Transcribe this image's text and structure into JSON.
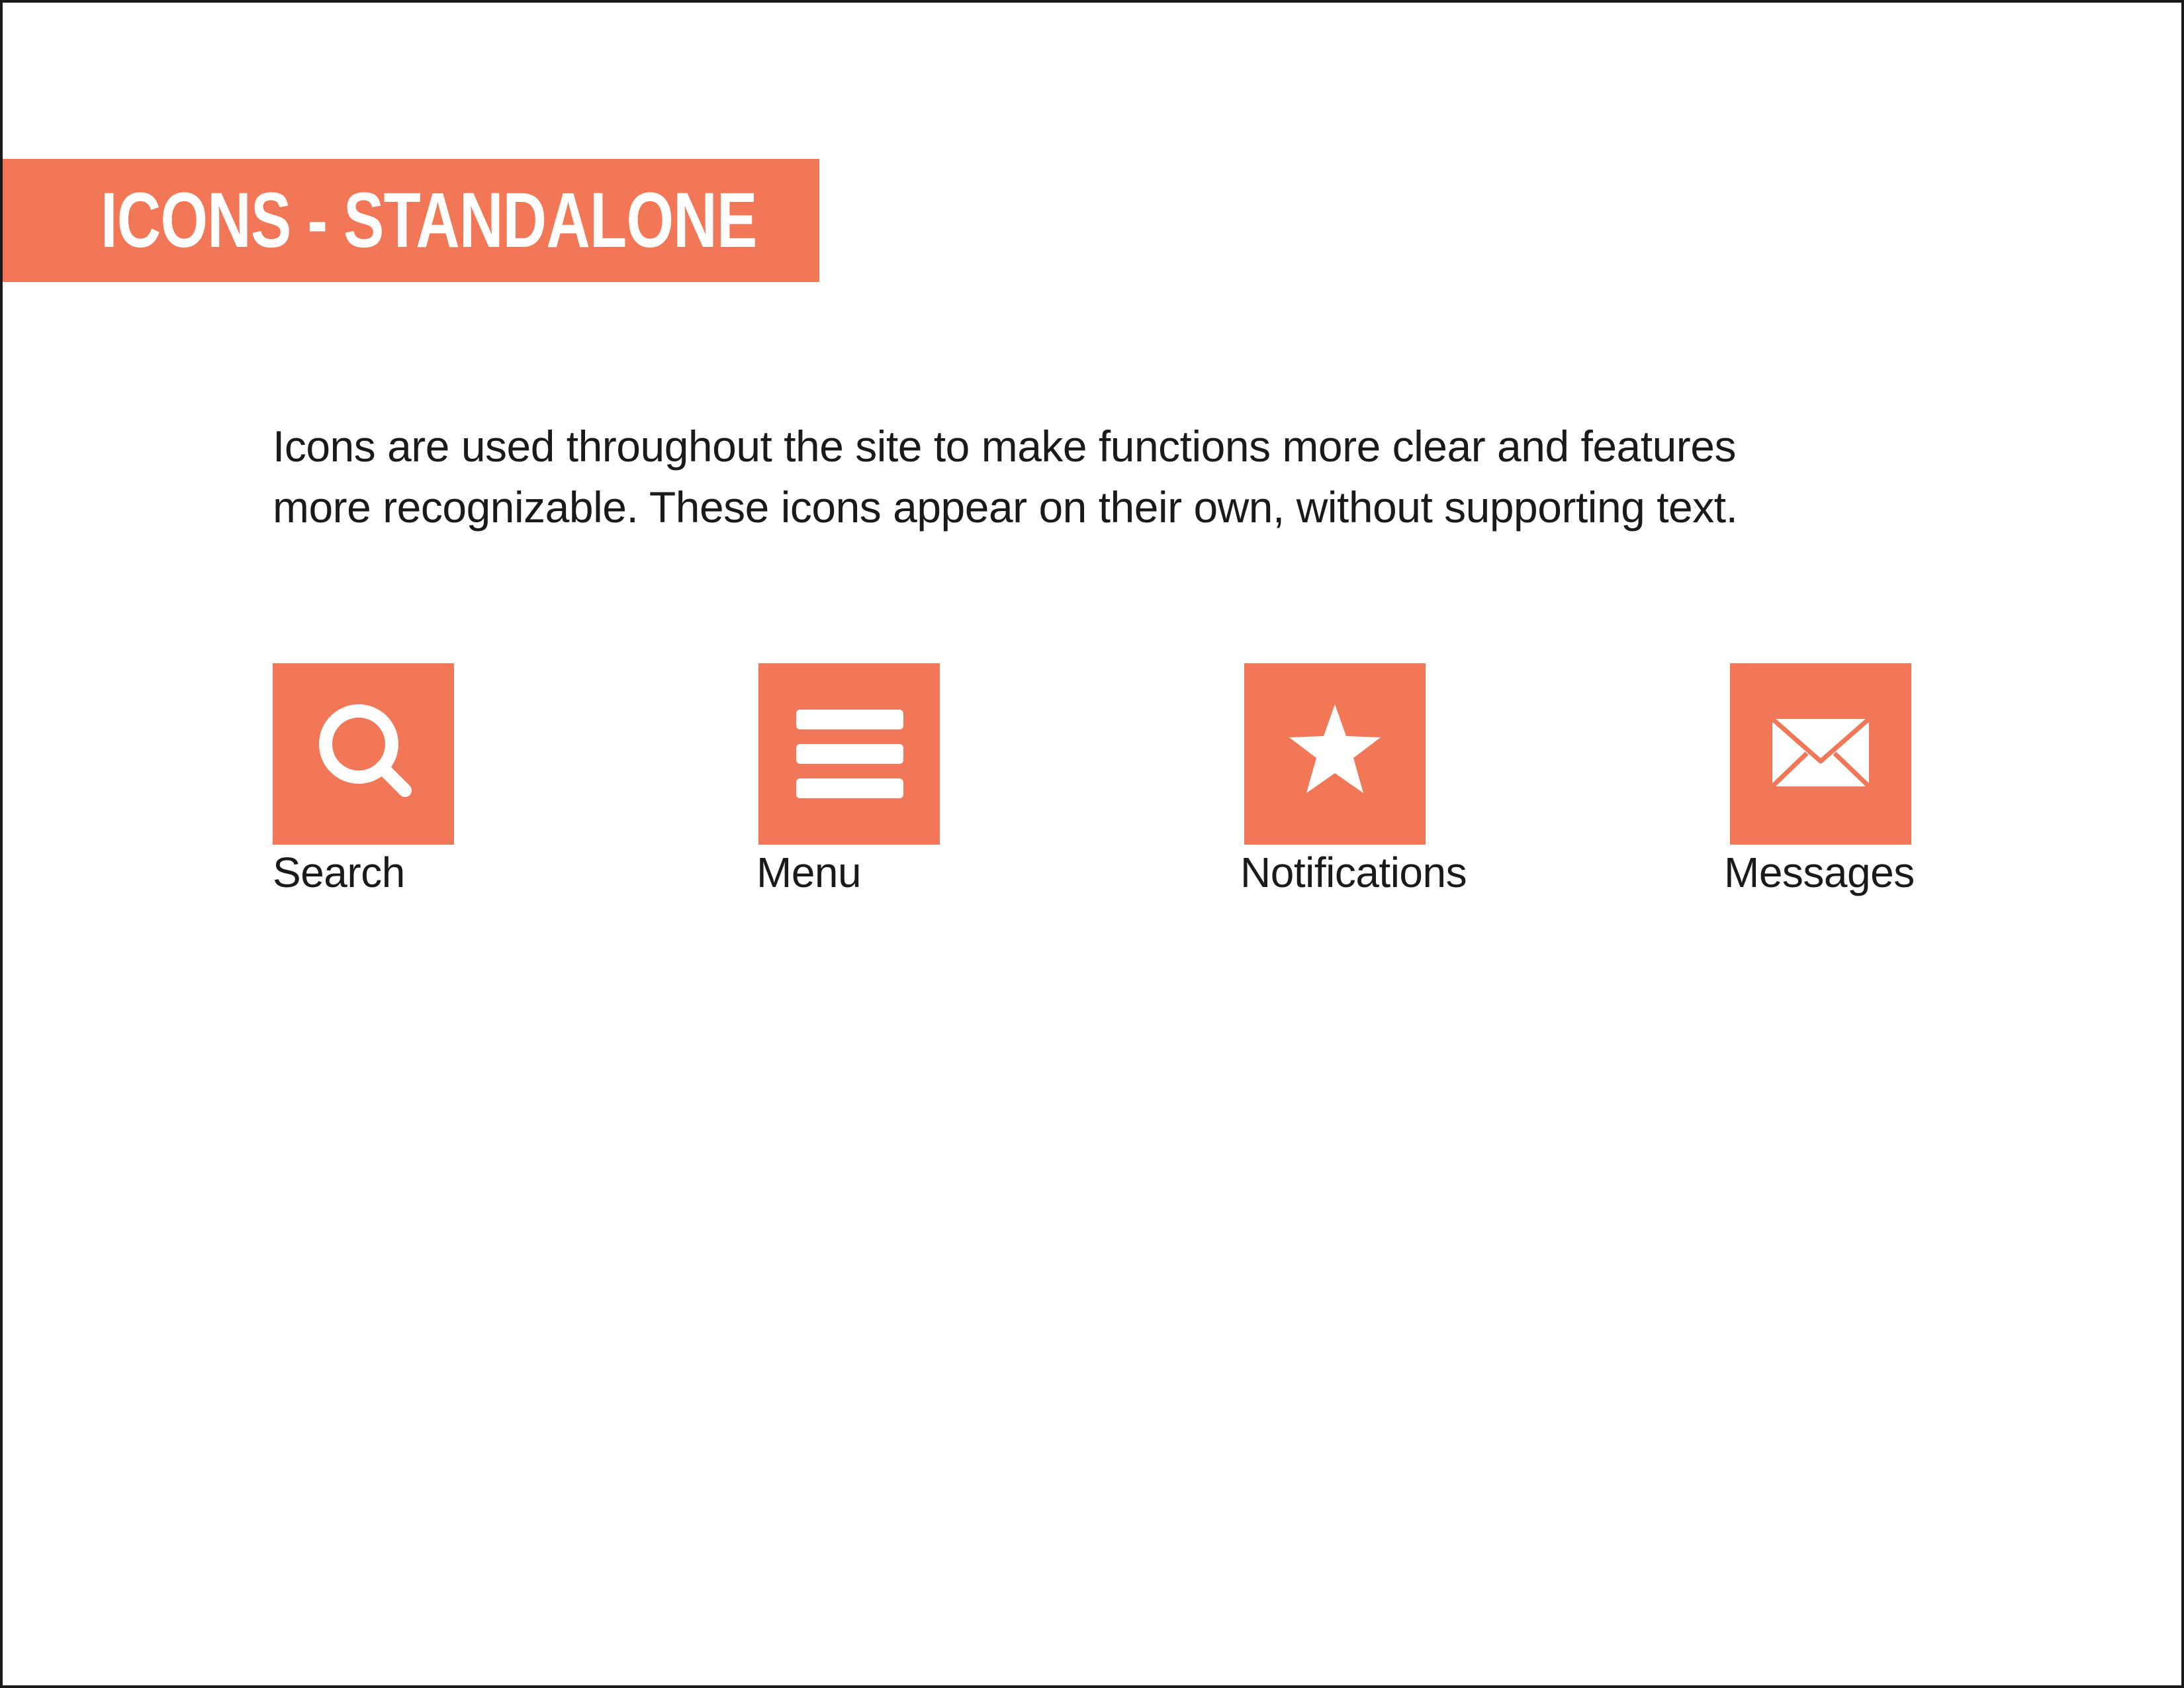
{
  "header": {
    "title": "ICONS - STANDALONE"
  },
  "intro": {
    "line_1": "Icons are used throughout the site to make functions more clear and features",
    "line_2": "more recognizable. These icons appear on their own, without supporting text."
  },
  "icons": [
    {
      "label": "Search",
      "icon": "search-icon"
    },
    {
      "label": "Menu",
      "icon": "menu-icon"
    },
    {
      "label": "Notifications",
      "icon": "star-icon"
    },
    {
      "label": "Messages",
      "icon": "envelope-icon"
    }
  ],
  "colors": {
    "accent": "#f27757",
    "text": "#1a1a1a",
    "background": "#ffffff",
    "icon_glyph": "#ffffff"
  }
}
